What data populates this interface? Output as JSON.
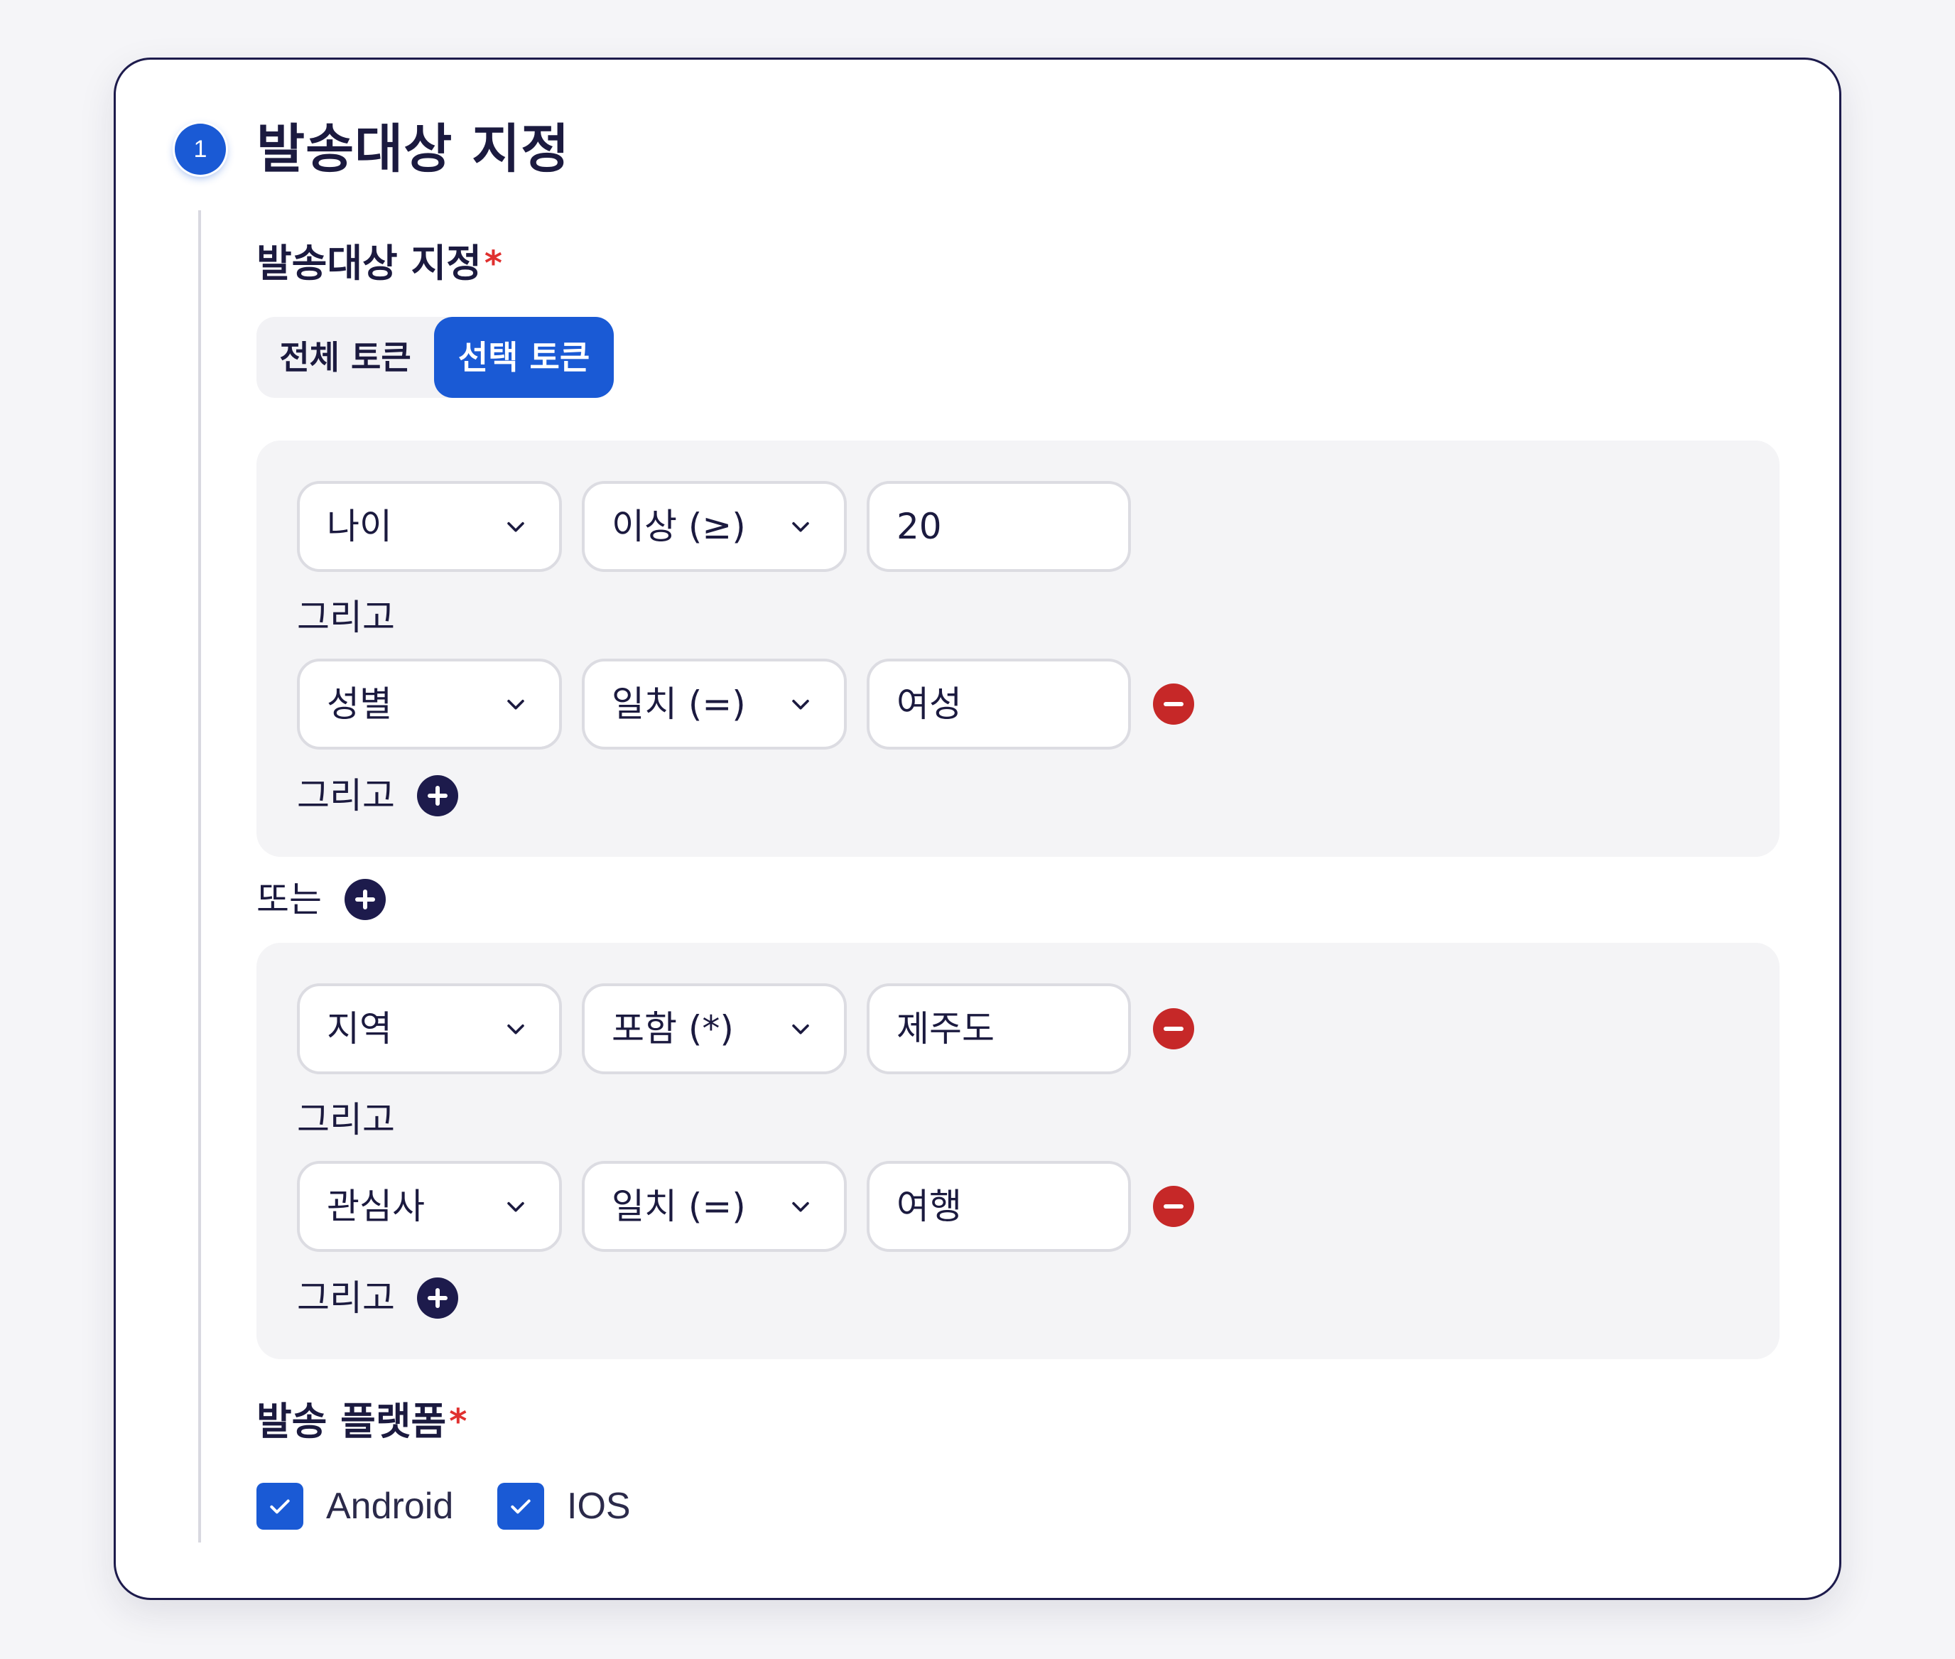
{
  "section": {
    "step_number": "1",
    "title": "발송대상 지정"
  },
  "target_field": {
    "label": "발송대상 지정",
    "required_mark": "*",
    "toggle_all": "전체 토큰",
    "toggle_selected": "선택 토큰",
    "selected_option": "선택 토큰"
  },
  "groups": [
    {
      "conditions": [
        {
          "field": "나이",
          "operator": "이상 (≥)",
          "value": "20"
        },
        {
          "field": "성별",
          "operator": "일치 (=)",
          "value": "여성"
        }
      ],
      "and_label_1": "그리고",
      "and_label_2": "그리고"
    },
    {
      "conditions": [
        {
          "field": "지역",
          "operator": "포함 (*)",
          "value": "제주도"
        },
        {
          "field": "관심사",
          "operator": "일치 (=)",
          "value": "여행"
        }
      ],
      "and_label_1": "그리고",
      "and_label_2": "그리고"
    }
  ],
  "or_label": "또는",
  "platform_field": {
    "label": "발송 플랫폼",
    "required_mark": "*",
    "options": [
      {
        "label": "Android",
        "checked": true
      },
      {
        "label": "IOS",
        "checked": true
      }
    ]
  },
  "colors": {
    "primary": "#1a5ad5",
    "navy": "#1d1b4c",
    "remove": "#c62828",
    "required": "#e0302f"
  },
  "icons": {
    "dropdown": "chevron-down-icon",
    "remove": "minus-circle-icon",
    "add": "plus-circle-icon",
    "checkbox": "check-icon"
  }
}
